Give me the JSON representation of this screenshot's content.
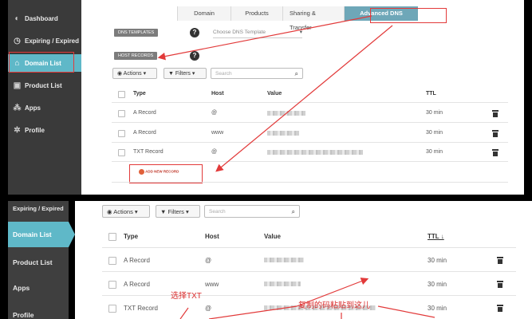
{
  "top": {
    "sidebar": [
      {
        "label": "Dashboard",
        "icon": "dashboard-icon"
      },
      {
        "label": "Expiring / Expired",
        "icon": "clock-icon"
      },
      {
        "label": "Domain List",
        "icon": "home-icon",
        "active": true
      },
      {
        "label": "Product List",
        "icon": "box-icon"
      },
      {
        "label": "Apps",
        "icon": "apps-icon"
      },
      {
        "label": "Profile",
        "icon": "gear-icon"
      }
    ],
    "tabs": [
      "Domain",
      "Products",
      "Sharing & Transfer",
      "Advanced DNS"
    ],
    "dns_templates_label": "DNS TEMPLATES",
    "dns_template_select": "Choose DNS Template",
    "host_records_label": "HOST RECORDS",
    "actions_label": "Actions",
    "filters_label": "Filters",
    "search_placeholder": "Search",
    "columns": {
      "type": "Type",
      "host": "Host",
      "value": "Value",
      "ttl": "TTL"
    },
    "rows": [
      {
        "type": "A Record",
        "host": "@",
        "ttl": "30 min"
      },
      {
        "type": "A Record",
        "host": "www",
        "ttl": "30 min"
      },
      {
        "type": "TXT Record",
        "host": "@",
        "ttl": "30 min"
      }
    ],
    "add_record": "ADD NEW RECORD"
  },
  "bottom": {
    "sidebar": [
      {
        "label": "Expiring / Expired"
      },
      {
        "label": "Domain List",
        "active": true
      },
      {
        "label": "Product List"
      },
      {
        "label": "Apps"
      },
      {
        "label": "Profile"
      }
    ],
    "actions_label": "Actions",
    "filters_label": "Filters",
    "search_placeholder": "Search",
    "columns": {
      "type": "Type",
      "host": "Host",
      "value": "Value",
      "ttl": "TTL ↓"
    },
    "rows": [
      {
        "type": "A Record",
        "host": "@",
        "ttl": "30 min"
      },
      {
        "type": "A Record",
        "host": "www",
        "ttl": "30 min"
      },
      {
        "type": "TXT Record",
        "host": "@",
        "ttl": "30 min"
      }
    ],
    "annotation_select_txt": "选择TXT",
    "annotation_paste": "复制的码粘贴到这儿"
  },
  "colors": {
    "accent": "#5fb8c8",
    "tab_active": "#6ea7b8",
    "annotation": "#e23a3a",
    "sidebar": "#3a3a3a"
  }
}
